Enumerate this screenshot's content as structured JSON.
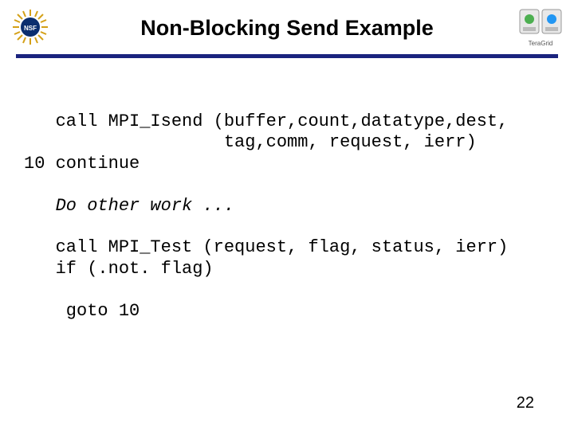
{
  "title": "Non-Blocking Send Example",
  "code": {
    "l1": "   call MPI_Isend (buffer,count,datatype,dest,",
    "l2": "                   tag,comm, request, ierr)",
    "l3": "10 continue",
    "l4": "",
    "l5": "   Do other work ...",
    "l6": "",
    "l7": "   call MPI_Test (request, flag, status, ierr)",
    "l8": "   if (.not. flag)",
    "l9": "",
    "l10": "    goto 10"
  },
  "page_number": "22",
  "logos": {
    "left_alt": "nsf-logo",
    "right_alt": "teragrid-logo",
    "right_text": "TeraGrid"
  },
  "colors": {
    "rule": "#1a237e"
  }
}
